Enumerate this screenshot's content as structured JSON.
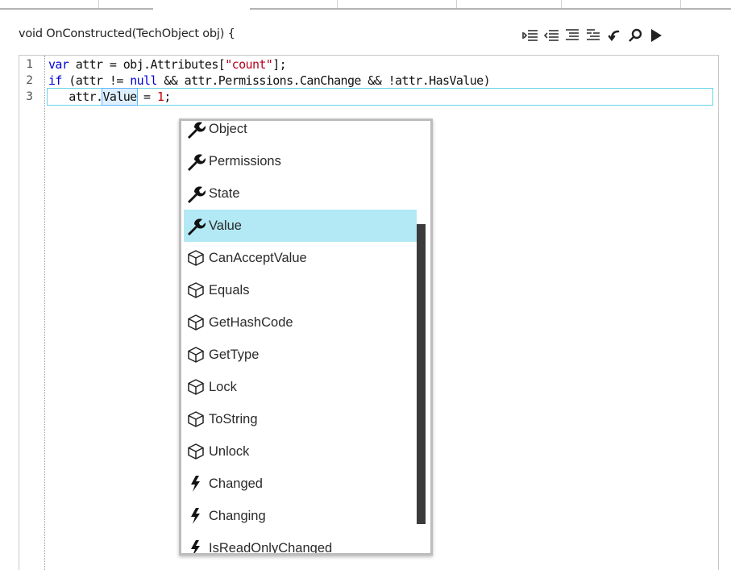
{
  "header": {
    "title": "void OnConstructed(TechObject obj) {"
  },
  "toolbar": {
    "buttons": [
      {
        "name": "increase-indent-icon"
      },
      {
        "name": "decrease-indent-icon"
      },
      {
        "name": "comment-lines-icon"
      },
      {
        "name": "uncomment-lines-icon"
      },
      {
        "name": "insert-snippet-icon"
      },
      {
        "name": "search-icon"
      },
      {
        "name": "run-icon"
      }
    ]
  },
  "editor": {
    "line_numbers": [
      "1",
      "2",
      "3"
    ],
    "lines": [
      {
        "kw": "var",
        "text": " attr = obj.Attributes[",
        "str": "\"count\"",
        "tail": "];"
      },
      {
        "kw": "if",
        "text": " (attr != ",
        "kw2": "null",
        "tail": " && attr.Permissions.CanChange && !attr.HasValue)"
      },
      {
        "indent": "   attr.",
        "word": "Value",
        "mid": " = ",
        "num": "1",
        "tail": ";"
      }
    ]
  },
  "completion": {
    "items": [
      {
        "label": "Object",
        "icon": "property-wrench-icon",
        "selected": false
      },
      {
        "label": "Permissions",
        "icon": "property-wrench-icon",
        "selected": false
      },
      {
        "label": "State",
        "icon": "property-wrench-icon",
        "selected": false
      },
      {
        "label": "Value",
        "icon": "property-wrench-icon",
        "selected": true
      },
      {
        "label": "CanAcceptValue",
        "icon": "method-cube-icon",
        "selected": false
      },
      {
        "label": "Equals",
        "icon": "method-cube-icon",
        "selected": false
      },
      {
        "label": "GetHashCode",
        "icon": "method-cube-icon",
        "selected": false
      },
      {
        "label": "GetType",
        "icon": "method-cube-icon",
        "selected": false
      },
      {
        "label": "Lock",
        "icon": "method-cube-icon",
        "selected": false
      },
      {
        "label": "ToString",
        "icon": "method-cube-icon",
        "selected": false
      },
      {
        "label": "Unlock",
        "icon": "method-cube-icon",
        "selected": false
      },
      {
        "label": "Changed",
        "icon": "event-lightning-icon",
        "selected": false
      },
      {
        "label": "Changing",
        "icon": "event-lightning-icon",
        "selected": false
      },
      {
        "label": "IsReadOnlyChanged",
        "icon": "event-lightning-icon",
        "selected": false
      }
    ],
    "colors": {
      "selected_bg": "#b3e9f5"
    }
  }
}
